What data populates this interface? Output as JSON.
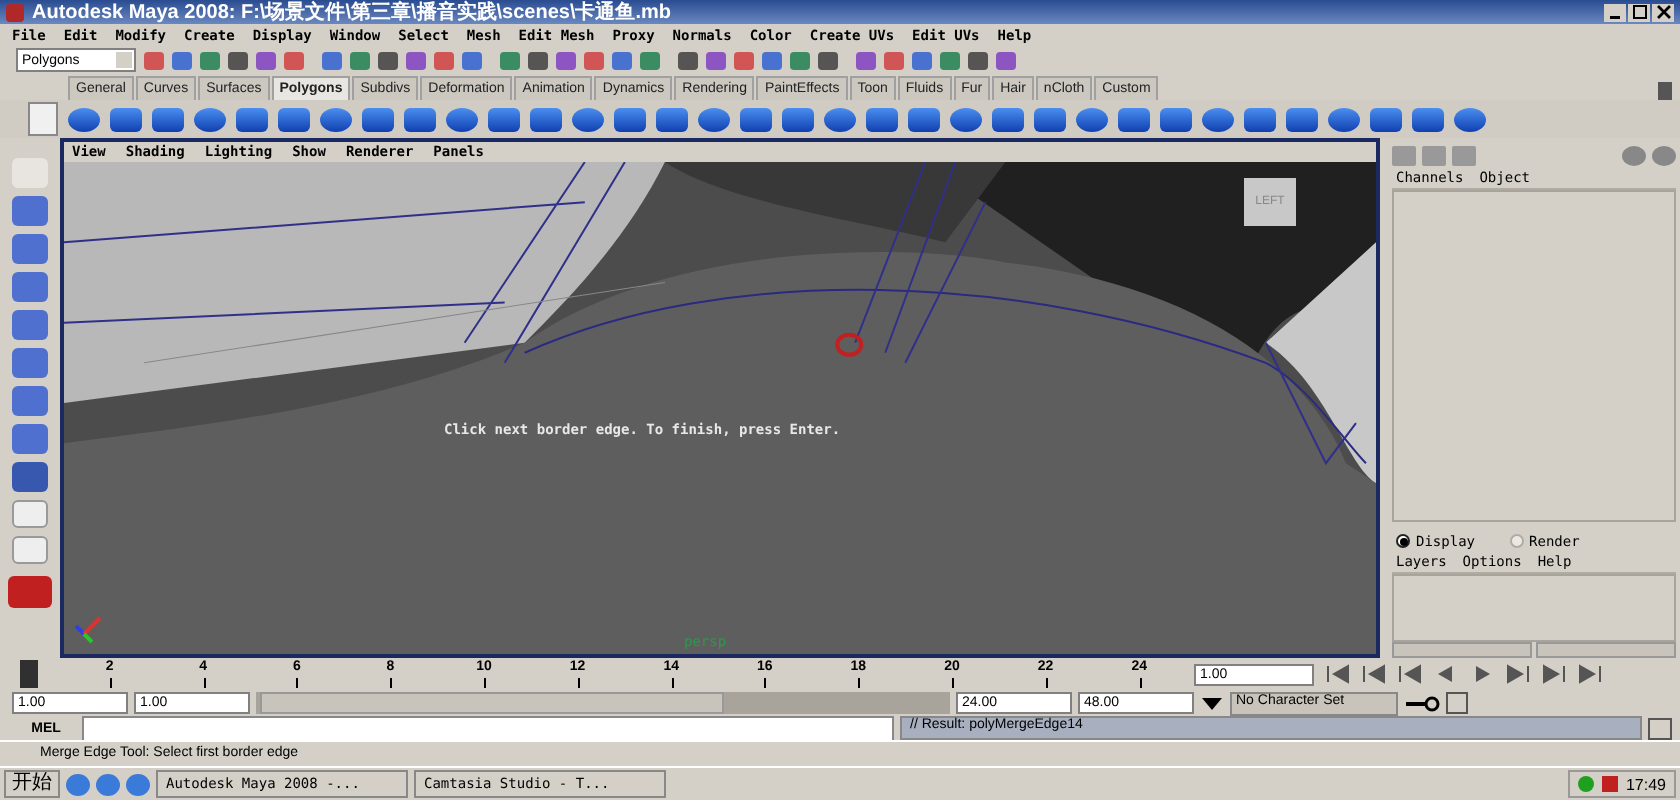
{
  "window": {
    "title": "Autodesk Maya 2008: F:\\场景文件\\第三章\\播音实践\\scenes\\卡通鱼.mb"
  },
  "menu_bar": [
    "File",
    "Edit",
    "Modify",
    "Create",
    "Display",
    "Window",
    "Select",
    "Mesh",
    "Edit Mesh",
    "Proxy",
    "Normals",
    "Color",
    "Create UVs",
    "Edit UVs",
    "Help"
  ],
  "status_line": {
    "menu_set": "Polygons"
  },
  "shelf_tabs": [
    {
      "label": "General",
      "selected": false
    },
    {
      "label": "Curves",
      "selected": false
    },
    {
      "label": "Surfaces",
      "selected": false
    },
    {
      "label": "Polygons",
      "selected": true
    },
    {
      "label": "Subdivs",
      "selected": false
    },
    {
      "label": "Deformation",
      "selected": false
    },
    {
      "label": "Animation",
      "selected": false
    },
    {
      "label": "Dynamics",
      "selected": false
    },
    {
      "label": "Rendering",
      "selected": false
    },
    {
      "label": "PaintEffects",
      "selected": false
    },
    {
      "label": "Toon",
      "selected": false
    },
    {
      "label": "Fluids",
      "selected": false
    },
    {
      "label": "Fur",
      "selected": false
    },
    {
      "label": "Hair",
      "selected": false
    },
    {
      "label": "nCloth",
      "selected": false
    },
    {
      "label": "Custom",
      "selected": false
    }
  ],
  "viewport": {
    "menu": [
      "View",
      "Shading",
      "Lighting",
      "Show",
      "Renderer",
      "Panels"
    ],
    "view_cube": "LEFT",
    "message": "Click next border edge. To finish, press Enter.",
    "camera": "persp"
  },
  "channel_box": {
    "menu": [
      "Channels",
      "Object"
    ]
  },
  "layer_editor": {
    "modes": [
      {
        "label": "Display",
        "selected": true
      },
      {
        "label": "Render",
        "selected": false
      }
    ],
    "menu": [
      "Layers",
      "Options",
      "Help"
    ]
  },
  "time_slider": {
    "ticks": [
      "2",
      "4",
      "6",
      "8",
      "10",
      "12",
      "14",
      "16",
      "18",
      "20",
      "22",
      "24"
    ],
    "current_time": "1.00",
    "level": 0
  },
  "range_slider": {
    "start_time": "1.00",
    "range_start": "1.00",
    "range_end": "24.00",
    "end_time": "48.00",
    "character_set": "No Character Set"
  },
  "command_line": {
    "label": "MEL",
    "result": "// Result: polyMergeEdge14"
  },
  "help_line": "Merge Edge Tool: Select first border edge",
  "taskbar": {
    "start": "开始",
    "tasks": [
      "Autodesk Maya 2008 -...",
      "Camtasia Studio - T..."
    ],
    "clock": "17:49"
  }
}
